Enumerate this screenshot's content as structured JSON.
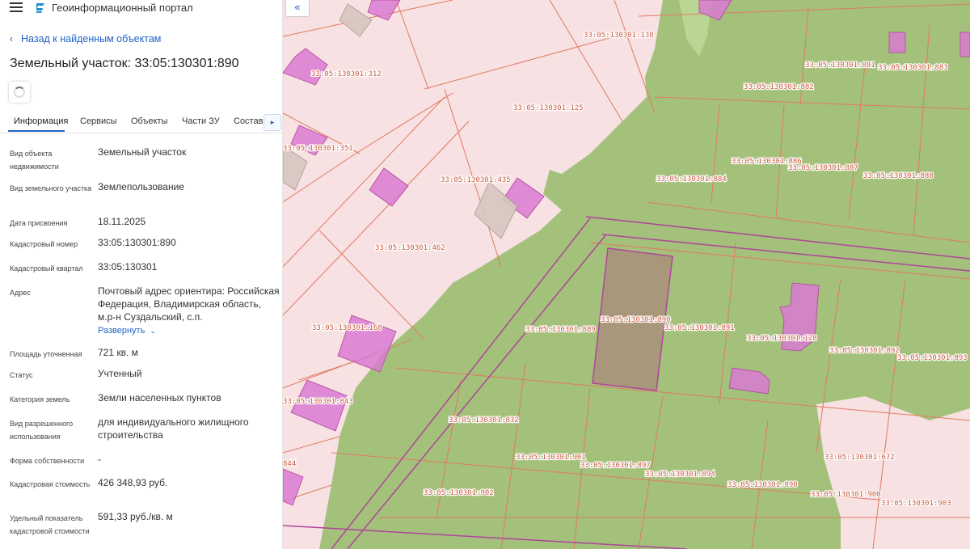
{
  "header": {
    "portal_title": "Геоинформационный портал"
  },
  "nav": {
    "back_label": "Назад к найденным объектам"
  },
  "page": {
    "title": "Земельный участок: 33:05:130301:890"
  },
  "tabs": [
    {
      "label": "Информация"
    },
    {
      "label": "Сервисы"
    },
    {
      "label": "Объекты"
    },
    {
      "label": "Части ЗУ"
    },
    {
      "label": "Состав"
    }
  ],
  "info": {
    "object_type_key": "Вид объекта недвижимости",
    "object_type_val": "Земельный участок",
    "land_kind_key": "Вид земельного участка",
    "land_kind_val": "Землепользование",
    "assign_date_key": "Дата присвоения",
    "assign_date_val": "18.11.2025",
    "cad_number_key": "Кадастровый номер",
    "cad_number_val": "33:05:130301:890",
    "cad_quarter_key": "Кадастровый квартал",
    "cad_quarter_val": "33:05:130301",
    "address_key": "Адрес",
    "address_val": "Почтовый адрес ориентира: Российская Федерация, Владимирская область, м.р-н Суздальский, с.п.",
    "address_expand": "Развернуть",
    "area_key": "Площадь уточненная",
    "area_val": "721 кв. м",
    "status_key": "Статус",
    "status_val": "Учтенный",
    "category_key": "Категория земель",
    "category_val": "Земли населенных пунктов",
    "permitted_use_key": "Вид разрешенного использования",
    "permitted_use_val": "для индивидуального жилищного строительства",
    "ownership_key": "Форма собственности",
    "ownership_val": "-",
    "cad_value_key": "Кадастровая стоимость",
    "cad_value_val": "426 348,93 руб.",
    "specific_key": "Удельный показатель кадастровой стоимости",
    "specific_val": "591,33 руб./кв. м"
  },
  "map": {
    "colors": {
      "background": "#f7e1e3",
      "green_zone": "#a3c17b",
      "parcel_line": "#e07a5f",
      "building": "#d97ad1",
      "selected_fill": "#a8927a",
      "road_line": "#b0449b"
    },
    "labels": [
      "33:05:130301:138",
      "33:05:130301:312",
      "33:05:130301:125",
      "33:05:130301:881",
      "33:05:130301:883",
      "33:05:130301:882",
      "33:05:130301:351",
      "33:05:130301:435",
      "33:05:130301:886",
      "33:05:130301:887",
      "33:05:130301:884",
      "33:05:130301:888",
      "33:05:130301:462",
      "33:05:130301:168",
      "33:05:130301:889",
      "33:05:130301:890",
      "33:05:130301:891",
      "33:05:130301:128",
      "33:05:130301:892",
      "33:05:130301:893",
      "33:05:130301:843",
      "33:05:130301:832",
      "33:05:130301:901",
      "33:05:130301:897",
      "33:05:130301:894",
      "33:05:130301:672",
      "33:05:130301:902",
      "33:05:130301:898",
      "33:05:130301:900",
      "33:05:130301:903",
      "844"
    ]
  }
}
